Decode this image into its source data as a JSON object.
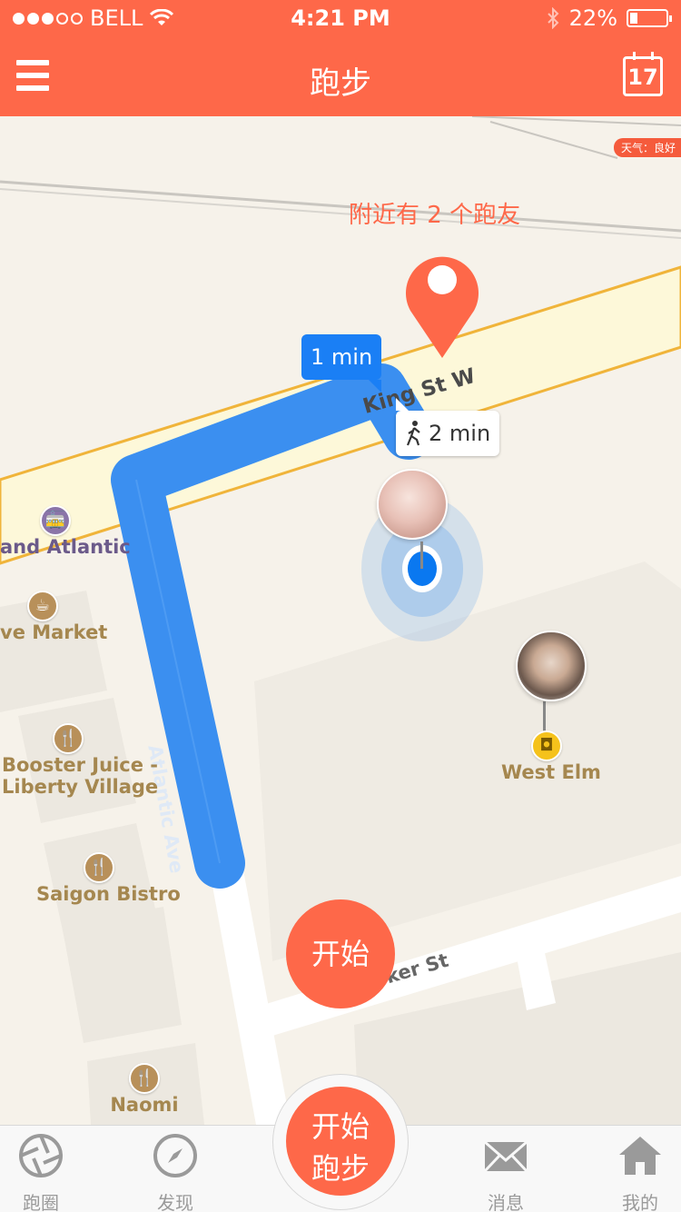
{
  "status_bar": {
    "carrier": "BELL",
    "time": "4:21 PM",
    "battery": "22%",
    "battery_level": 0.22
  },
  "nav": {
    "title": "跑步",
    "calendar_day": "17"
  },
  "map": {
    "weather": "天气：良好",
    "nearby_text": "附近有 2 个跑友",
    "drive_time": "1 min",
    "walk_time": "2 min",
    "roads": {
      "king": "King St W",
      "atlantic": "Atlantic Ave",
      "liberty": "oker St"
    },
    "pois": {
      "atlantic_station": "and Atlantic",
      "market": "ve Market",
      "booster_line1": "Booster Juice -",
      "booster_line2": "Liberty Village",
      "saigon": "Saigon Bistro",
      "naomi": "Naomi",
      "west_elm": "West Elm"
    },
    "start_button": "开始"
  },
  "tabbar": {
    "tab1": "跑圈",
    "tab2": "发现",
    "center_line1": "开始",
    "center_line2": "跑步",
    "tab4": "消息",
    "tab5": "我的"
  },
  "colors": {
    "accent": "#fe6849",
    "route": "#3b8ff0",
    "user_dot": "#0a78f0"
  }
}
